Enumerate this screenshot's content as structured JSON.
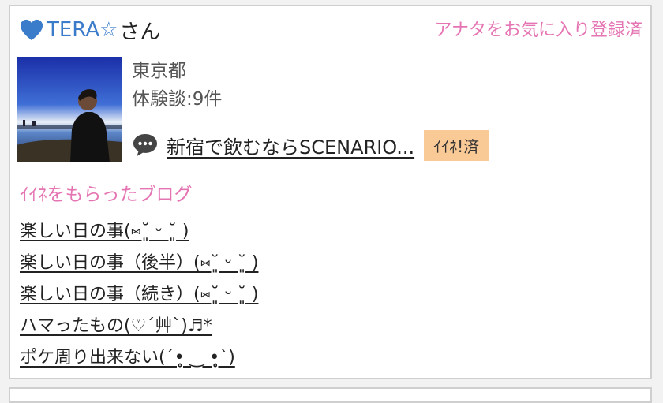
{
  "user": {
    "name": "TERA☆",
    "honorific": "さん",
    "favorite_status": "アナタをお気に入り登録済",
    "location": "東京都",
    "experience_count": "体験談:9件"
  },
  "latest_post": {
    "title": "新宿で飲むならSCENARIO...",
    "iine_label": "ｲｲﾈ!済"
  },
  "blogs_section": {
    "title": "ｲｲﾈをもらったブログ",
    "items": [
      "楽しい日の事(⑅˘͈ ᵕ ˘͈ )",
      "楽しい日の事（後半）(⑅˘͈ ᵕ ˘͈ )",
      "楽しい日の事（続き）(⑅˘͈ ᵕ ˘͈ )",
      "ハマったもの(♡´艸`)♬*",
      "ポケ周り出来ない(´•̥̥̥ ‿ •̥̥̥`)"
    ]
  },
  "colors": {
    "name_blue": "#3a7cc9",
    "accent_pink": "#e574b3",
    "badge_orange": "#f9c996"
  },
  "icons": [
    "heart-icon",
    "chat-bubble-icon"
  ]
}
